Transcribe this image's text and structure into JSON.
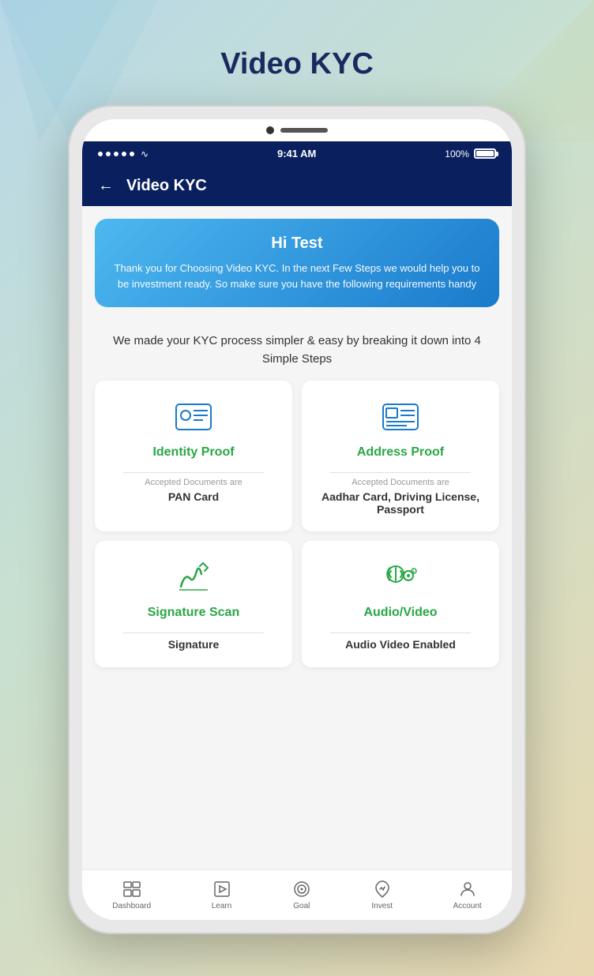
{
  "page": {
    "title": "Video KYC"
  },
  "status_bar": {
    "time": "9:41 AM",
    "battery": "100%"
  },
  "nav": {
    "back_label": "←",
    "title": "Video KYC"
  },
  "hi_card": {
    "greeting": "Hi Test",
    "description": "Thank you for Choosing Video KYC. In the next Few Steps we would help you to be investment ready. So make sure you have the following requirements handy"
  },
  "steps_description": "We made your KYC process simpler & easy by breaking it down into 4 Simple Steps",
  "kyc_cards": [
    {
      "id": "identity-proof",
      "title": "Identity Proof",
      "subtitle": "Accepted Documents are",
      "document": "PAN Card"
    },
    {
      "id": "address-proof",
      "title": "Address Proof",
      "subtitle": "Accepted Documents are",
      "document": "Aadhar Card, Driving License, Passport"
    },
    {
      "id": "signature-scan",
      "title": "Signature Scan",
      "subtitle": "",
      "document": "Signature"
    },
    {
      "id": "audio-video",
      "title": "Audio/Video",
      "subtitle": "",
      "document": "Audio Video Enabled"
    }
  ],
  "bottom_nav": [
    {
      "id": "dashboard",
      "label": "Dashboard"
    },
    {
      "id": "learn",
      "label": "Learn"
    },
    {
      "id": "goal",
      "label": "Goal"
    },
    {
      "id": "invest",
      "label": "Invest"
    },
    {
      "id": "account",
      "label": "Account"
    }
  ]
}
